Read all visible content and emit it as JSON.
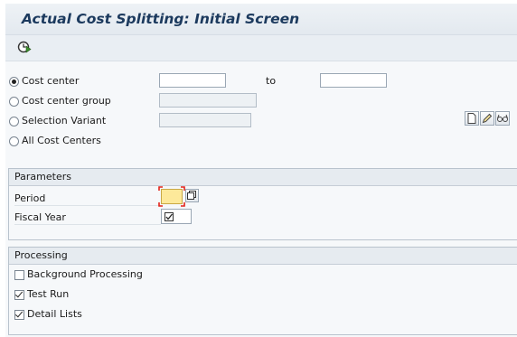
{
  "title": "Actual Cost Splitting: Initial Screen",
  "toolbar": {
    "execute_icon": "execute-clock-icon"
  },
  "selection": {
    "cost_center_label": "Cost center",
    "cost_center_from": "",
    "to_label": "to",
    "cost_center_to": "",
    "cost_center_group_label": "Cost center group",
    "cost_center_group_value": "",
    "selection_variant_label": "Selection Variant",
    "selection_variant_value": "",
    "all_cost_centers_label": "All Cost Centers",
    "selected_option": "Cost center"
  },
  "parameters": {
    "header": "Parameters",
    "period_label": "Period",
    "period_value": "",
    "fiscal_year_label": "Fiscal Year",
    "fiscal_year_value": ""
  },
  "processing": {
    "header": "Processing",
    "background_label": "Background Processing",
    "background_checked": false,
    "test_run_label": "Test Run",
    "test_run_checked": true,
    "detail_lists_label": "Detail Lists",
    "detail_lists_checked": true
  },
  "colors": {
    "title": "#1c3a5e",
    "required_field_bg": "#fde99a",
    "required_marker": "#e2231a"
  }
}
